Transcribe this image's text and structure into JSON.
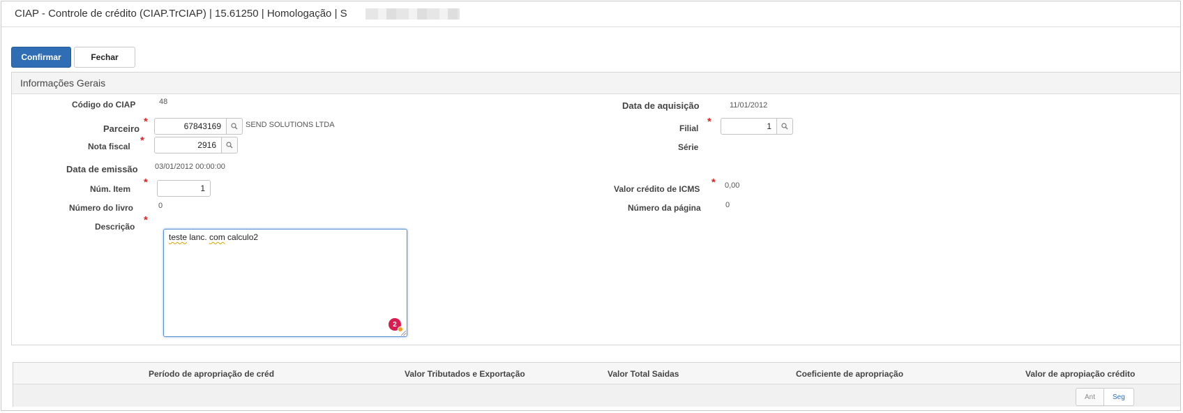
{
  "window": {
    "title": "CIAP - Controle de crédito (CIAP.TrCIAP) | 15.61250 | Homologação | S"
  },
  "toolbar": {
    "confirm_label": "Confirmar",
    "close_label": "Fechar"
  },
  "panel": {
    "title": "Informações Gerais"
  },
  "fields": {
    "codigo_ciap": {
      "label": "Código do CIAP",
      "value": "48"
    },
    "data_aquisicao": {
      "label": "Data de aquisição",
      "value": "11/01/2012"
    },
    "parceiro": {
      "label": "Parceiro",
      "value": "67843169",
      "name": "SEND SOLUTIONS LTDA"
    },
    "filial": {
      "label": "Filial",
      "value": "1"
    },
    "nota_fiscal": {
      "label": "Nota fiscal",
      "value": "2916"
    },
    "serie": {
      "label": "Série"
    },
    "data_emissao": {
      "label": "Data de emissão",
      "value": "03/01/2012 00:00:00"
    },
    "num_item": {
      "label": "Núm. Item",
      "value": "1"
    },
    "valor_credito_icms": {
      "label": "Valor crédito de ICMS",
      "value": "0,00"
    },
    "numero_livro": {
      "label": "Número do livro",
      "value": "0"
    },
    "numero_pagina": {
      "label": "Número da página",
      "value": "0"
    },
    "descricao": {
      "label": "Descrição",
      "value_parts": [
        "teste",
        " lanc. ",
        "com",
        " calculo2"
      ]
    }
  },
  "required_mark": "*",
  "textarea_badge": "2",
  "grid": {
    "columns": [
      "Período de apropriação de créd",
      "Valor Tributados e Exportação",
      "Valor Total Saidas",
      "Coeficiente de apropriação",
      "Valor de apropiação crédito"
    ],
    "pager": {
      "prev_label": "Ant",
      "next_label": "Seg"
    }
  },
  "icons": {
    "lookup": "search-icon"
  },
  "colors": {
    "primary": "#2f6db5",
    "required": "#e02020",
    "badge": "#d81e50"
  }
}
